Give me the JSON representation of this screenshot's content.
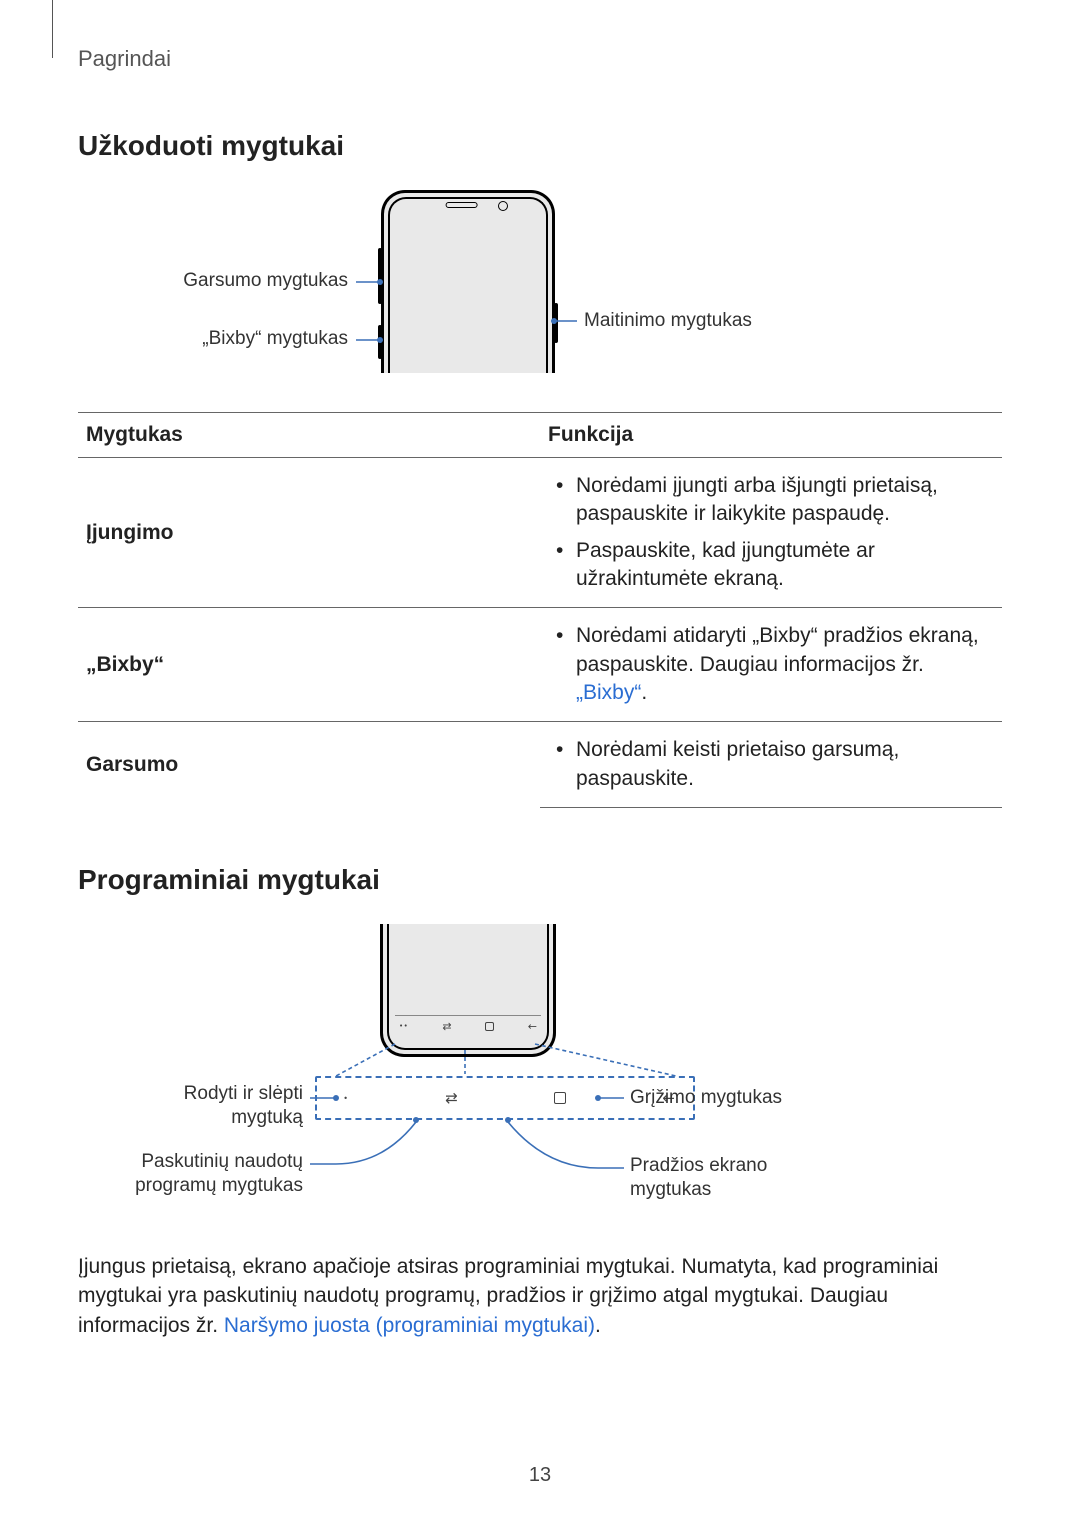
{
  "running_head": "Pagrindai",
  "section1_title": "Užkoduoti mygtukai",
  "diagram1": {
    "volume_label": "Garsumo mygtukas",
    "bixby_label": "„Bixby“ mygtukas",
    "power_label": "Maitinimo mygtukas"
  },
  "table": {
    "head_key": "Mygtukas",
    "head_func": "Funkcija",
    "rows": [
      {
        "key": "Įjungimo",
        "funcs": [
          "Norėdami įjungti arba išjungti prietaisą, paspauskite ir laikykite paspaudę.",
          "Paspauskite, kad įjungtumėte ar užrakintumėte ekraną."
        ]
      },
      {
        "key": "„Bixby“",
        "funcs_prefix": "Norėdami atidaryti „Bixby“ pradžios ekraną, paspauskite. Daugiau informacijos žr. ",
        "funcs_link": "„Bixby“",
        "funcs_suffix": "."
      },
      {
        "key": "Garsumo",
        "funcs": [
          "Norėdami keisti prietaiso garsumą, paspauskite."
        ]
      }
    ]
  },
  "section2_title": "Programiniai mygtukai",
  "diagram2": {
    "show_hide": "Rodyti ir slėpti mygtuką",
    "recents": "Paskutinių naudotų programų mygtukas",
    "back": "Grįžimo mygtukas",
    "home": "Pradžios ekrano mygtukas"
  },
  "paragraph_prefix": "Įjungus prietaisą, ekrano apačioje atsiras programiniai mygtukai. Numatyta, kad programiniai mygtukai yra paskutinių naudotų programų, pradžios ir grįžimo atgal mygtukai. Daugiau informacijos žr. ",
  "paragraph_link": "Naršymo juosta (programiniai mygtukai)",
  "paragraph_suffix": ".",
  "page_number": "13"
}
